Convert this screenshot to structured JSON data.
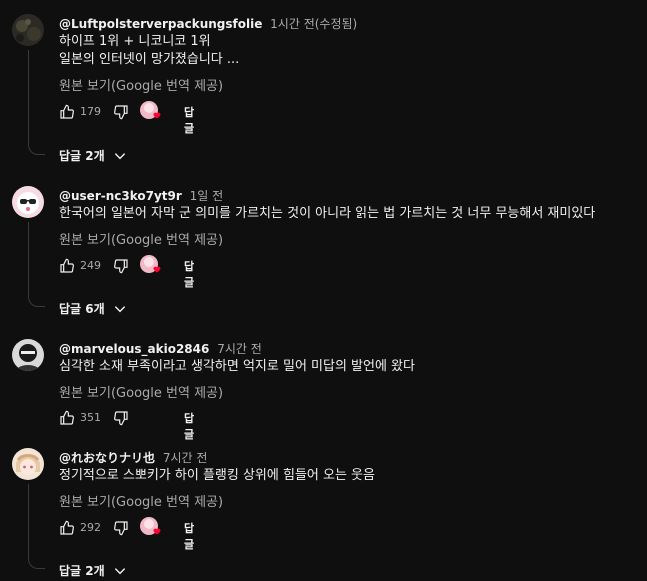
{
  "comments": [
    {
      "author": "@Luftpolsterverpackungsfolie",
      "time": "1시간 전(수정됨)",
      "lines": [
        "하이프 1위 + 니코니코 1위",
        "일본의 인터넷이 망가졌습니다 ..."
      ],
      "translate": "원본 보기(Google 번역 제공)",
      "likes": "179",
      "reply": "답글",
      "replies": "답글 2개",
      "avatar_icon": "dark-textured-avatar-icon"
    },
    {
      "author": "@user-nc3ko7yt9r",
      "time": "1일 전",
      "lines": [
        "한국어의 일본어 자막 군 의미를 가르치는 것이 아니라 읽는 법 가르치는 것 너무 무능해서 재미있다"
      ],
      "translate": "원본 보기(Google 번역 제공)",
      "likes": "249",
      "reply": "답글",
      "replies": "답글 6개",
      "avatar_icon": "pink-sunglasses-avatar-icon"
    },
    {
      "author": "@marvelous_akio2846",
      "time": "7시간 전",
      "lines": [
        "심각한 소재 부족이라고 생각하면 억지로 밀어 미답의 발언에 왔다"
      ],
      "translate": "원본 보기(Google 번역 제공)",
      "likes": "351",
      "reply": "답글",
      "replies": "",
      "avatar_icon": "grayscale-character-avatar-icon"
    },
    {
      "author": "@れおなりナリ也",
      "time": "7시간 전",
      "lines": [
        "정기적으로 스뽀키가 하이 플랭킹 상위에 힘들어 오는 웃음"
      ],
      "translate": "원본 보기(Google 번역 제공)",
      "likes": "292",
      "reply": "답글",
      "replies": "답글 2개",
      "avatar_icon": "anime-girl-avatar-icon"
    }
  ],
  "colors": {
    "background": "#0f0f0f",
    "text": "#f1f1f1",
    "muted": "#aaaaaa",
    "heart": "#ff0033"
  }
}
